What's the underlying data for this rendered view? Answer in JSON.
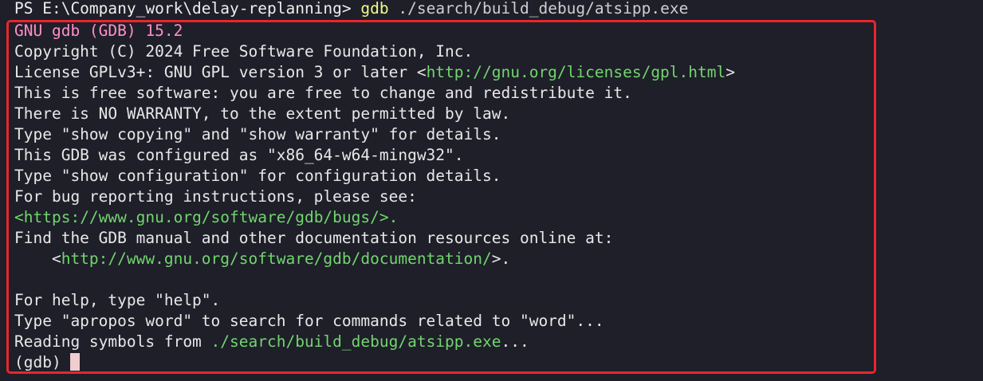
{
  "terminal": {
    "prompt": "PS E:\\Company_work\\delay-replanning> ",
    "command": "gdb",
    "command_arg": " ./search/build_debug/atsipp.exe",
    "gdb_version": "GNU gdb (GDB) 15.2",
    "copyright": "Copyright (C) 2024 Free Software Foundation, Inc.",
    "license_prefix": "License GPLv3+: GNU GPL version 3 or later <",
    "license_url": "http://gnu.org/licenses/gpl.html",
    "license_suffix": ">",
    "free_software": "This is free software: you are free to change and redistribute it.",
    "warranty": "There is NO WARRANTY, to the extent permitted by law.",
    "show_copying": "Type \"show copying\" and \"show warranty\" for details.",
    "configured": "This GDB was configured as \"x86_64-w64-mingw32\".",
    "show_config": "Type \"show configuration\" for configuration details.",
    "bug_reporting": "For bug reporting instructions, please see:",
    "bug_url_prefix": "<",
    "bug_url": "https://www.gnu.org/software/gdb/bugs/",
    "bug_url_suffix": ">.",
    "manual": "Find the GDB manual and other documentation resources online at:",
    "doc_prefix": "    <",
    "doc_url": "http://www.gnu.org/software/gdb/documentation/",
    "doc_suffix": ">.",
    "help": "For help, type \"help\".",
    "apropos": "Type \"apropos word\" to search for commands related to \"word\"...",
    "reading_prefix": "Reading symbols from ",
    "reading_path": "./search/build_debug/atsipp.exe",
    "reading_suffix": "...",
    "gdb_prompt": "(gdb)",
    "cut_line": "           ."
  },
  "colors": {
    "background": "#1e1f29",
    "highlight_border": "#e8262d",
    "url_green": "#72d56e",
    "version_pink": "#ff8fc8",
    "command_yellow": "#f1fa8c"
  }
}
